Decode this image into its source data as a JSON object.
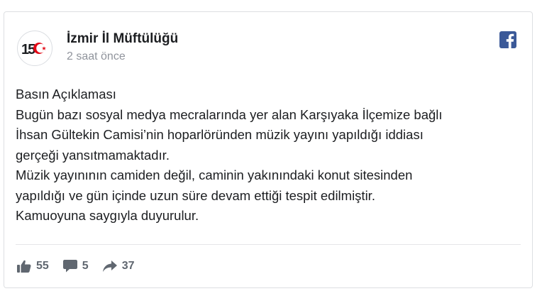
{
  "post": {
    "author": "İzmir İl Müftülüğü",
    "time": "2 saat önce",
    "lines": [
      "Basın Açıklaması",
      "Bugün bazı sosyal medya mecralarında yer alan Karşıyaka İlçemize bağlı",
      "İhsan Gültekin Camisi’nin hoparlöründen müzik yayını yapıldığı iddiası",
      "gerçeği yansıtmamaktadır.",
      "Müzik yayınının camiden değil, caminin yakınındaki konut sitesinden",
      "yapıldığı ve gün içinde uzun süre devam ettiği tespit edilmiştir.",
      "Kamuoyuna saygıyla duyurulur."
    ]
  },
  "avatar": {
    "text": "15",
    "icon": "crescent-star-logo"
  },
  "stats": {
    "likes": "55",
    "comments": "5",
    "shares": "37"
  },
  "icons": {
    "brand": "facebook-icon",
    "like": "thumbs-up-icon",
    "comment": "comment-bubble-icon",
    "share": "share-arrow-icon"
  },
  "colors": {
    "facebook_blue": "#3b5998",
    "muted": "#606770",
    "time": "#90949c"
  }
}
